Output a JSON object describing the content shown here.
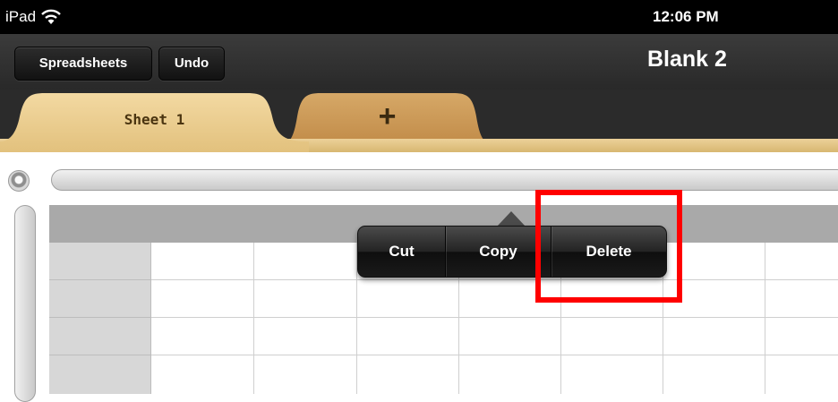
{
  "statusbar": {
    "carrier": "iPad",
    "time": "12:06 PM",
    "wifi_icon": "wifi-icon"
  },
  "toolbar": {
    "spreadsheets_label": "Spreadsheets",
    "undo_label": "Undo",
    "title": "Blank 2"
  },
  "tabs": {
    "sheet_label": "Sheet 1",
    "add_label": "+"
  },
  "edit_menu": {
    "items": [
      {
        "label": "Cut"
      },
      {
        "label": "Copy"
      },
      {
        "label": "Delete"
      }
    ]
  },
  "colors": {
    "tab_active": "#ecd199",
    "tab_inactive": "#cc9a5c",
    "highlight": "#ff0000",
    "header_gray": "#a9a9a9"
  }
}
